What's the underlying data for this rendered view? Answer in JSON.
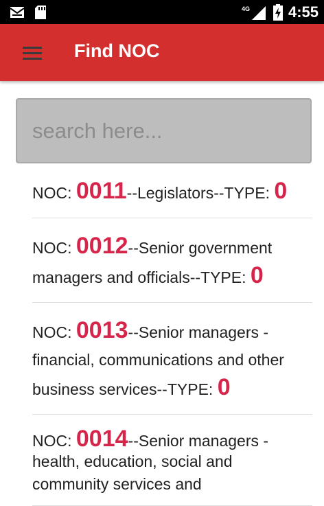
{
  "statusbar": {
    "network": "4G",
    "time": "4:55"
  },
  "appbar": {
    "title": "Find NOC",
    "menu_icon": "hamburger-menu-icon"
  },
  "search": {
    "placeholder": "search here..."
  },
  "list": {
    "items": [
      {
        "prefix": "NOC: ",
        "code": "0011",
        "description": "--Legislators--TYPE: ",
        "type": "0"
      },
      {
        "prefix": "NOC: ",
        "code": "0012",
        "description": "--Senior government managers and officials--TYPE: ",
        "type": "0"
      },
      {
        "prefix": "NOC: ",
        "code": "0013",
        "description": "--Senior managers - financial, communications and other business services--TYPE: ",
        "type": "0"
      },
      {
        "prefix": "NOC: ",
        "code": "0014",
        "description": "--Senior managers - health, education, social and community services and",
        "type": ""
      }
    ]
  },
  "colors": {
    "appbar": "#d32f2f",
    "accent": "#d6254a",
    "search_bg": "#bdbdbd"
  }
}
